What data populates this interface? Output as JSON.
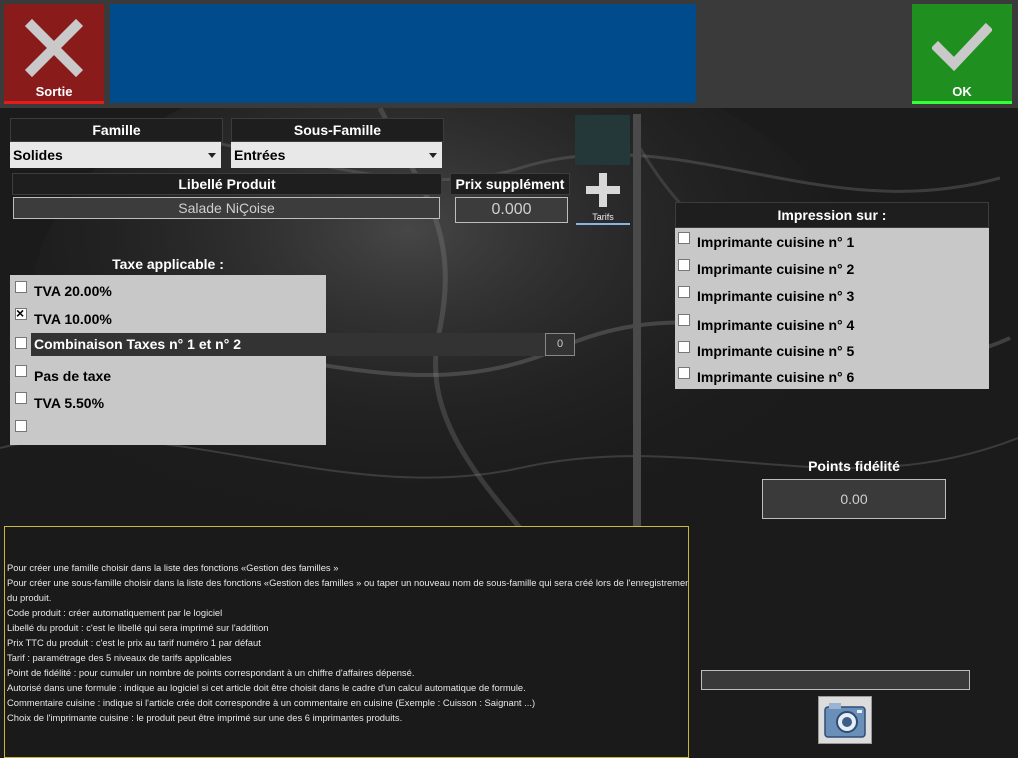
{
  "header": {
    "exit_label": "Sortie",
    "ok_label": "OK"
  },
  "product": {
    "famille_label": "Famille",
    "famille_value": "Solides",
    "sous_famille_label": "Sous-Famille",
    "sous_famille_value": "Entrées",
    "libelle_label": "Libellé Produit",
    "libelle_value": "Salade NiÇoise",
    "prix_label": "Prix supplément",
    "prix_value": "0.000",
    "tarifs_label": "Tarifs"
  },
  "taxes": {
    "title": "Taxe applicable :",
    "options": [
      {
        "label": "TVA 20.00%",
        "checked": false
      },
      {
        "label": "TVA 10.00%",
        "checked": true
      },
      {
        "label": "Combinaison Taxes n° 1 et n° 2",
        "checked": false,
        "value": "0"
      },
      {
        "label": "Pas de taxe",
        "checked": false
      },
      {
        "label": "TVA 5.50%",
        "checked": false
      },
      {
        "label": "",
        "checked": false
      }
    ]
  },
  "printing": {
    "title": "Impression sur :",
    "printers": [
      {
        "label": "Imprimante cuisine n° 1",
        "checked": false
      },
      {
        "label": "Imprimante cuisine n° 2",
        "checked": false
      },
      {
        "label": "Imprimante cuisine n° 3",
        "checked": false
      },
      {
        "label": "Imprimante cuisine n° 4",
        "checked": false
      },
      {
        "label": "Imprimante cuisine n° 5",
        "checked": false
      },
      {
        "label": "Imprimante cuisine n° 6",
        "checked": false
      }
    ]
  },
  "loyalty": {
    "title": "Points fidélité",
    "value": "0.00"
  },
  "help": {
    "lines": [
      "Pour créer une famille choisir dans la liste des fonctions «Gestion des familles »",
      "Pour créer une sous-famille choisir dans la liste des fonctions «Gestion des familles » ou taper un nouveau nom de sous-famille qui sera créé lors de l'enregistrement",
      "du produit.",
      "Code produit : créer automatiquement par le logiciel",
      "Libellé du produit : c'est le libellé qui sera imprimé sur l'addition",
      "Prix TTC du produit : c'est le prix au tarif numéro 1 par défaut",
      "Tarif : paramétrage des 5 niveaux de tarifs applicables",
      "Point de fidélité : pour cumuler un nombre de points correspondant à un chiffre d'affaires dépensé.",
      "Autorisé dans une formule : indique au logiciel si cet article doit être choisit dans le cadre d'un calcul automatique de formule.",
      "Commentaire cuisine : indique si l'article crée doit correspondre à un commentaire en cuisine (Exemple : Cuisson : Saignant ...)",
      "Choix de l'imprimante cuisine : le produit peut être imprimé sur une des 6 imprimantes produits."
    ]
  },
  "colors": {
    "exit": "#8a1b1b",
    "ok": "#1f8f1f",
    "title_area": "#004b8c",
    "help_border": "#c9b83a"
  }
}
